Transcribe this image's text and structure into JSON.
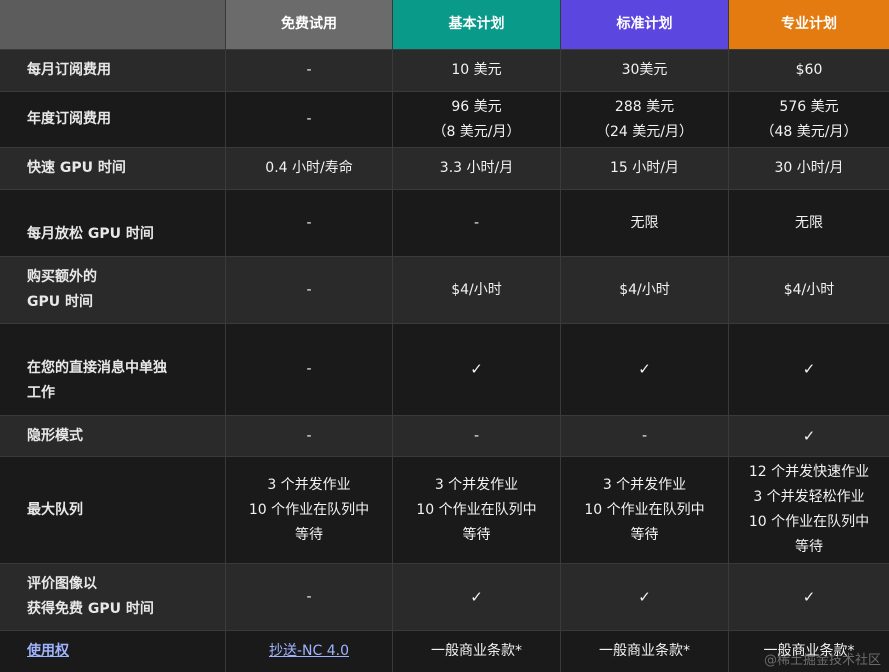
{
  "header": {
    "free": "免费试用",
    "basic": "基本计划",
    "standard": "标准计划",
    "pro": "专业计划"
  },
  "rows": {
    "monthly_fee": {
      "label": "每月订阅费用",
      "free": "-",
      "basic": "10 美元",
      "standard": "30美元",
      "pro": "$60"
    },
    "annual_fee": {
      "label": "年度订阅费用",
      "free": "-",
      "basic_1": "96 美元",
      "basic_2": "（8 美元/月）",
      "standard_1": "288 美元",
      "standard_2": "（24 美元/月）",
      "pro_1": "576 美元",
      "pro_2": "（48 美元/月）"
    },
    "fast_gpu": {
      "label": "快速 GPU 时间",
      "free": "0.4 小时/寿命",
      "basic": "3.3 小时/月",
      "standard": "15 小时/月",
      "pro": "30 小时/月"
    },
    "relax_gpu": {
      "label": "每月放松 GPU 时间",
      "free": "-",
      "basic": "-",
      "standard": "无限",
      "pro": "无限"
    },
    "extra_gpu": {
      "label_1": "购买额外的",
      "label_2": "GPU 时间",
      "free": "-",
      "basic": "$4/小时",
      "standard": "$4/小时",
      "pro": "$4/小时"
    },
    "dm_work": {
      "label_1": "在您的直接消息中单独",
      "label_2": "工作",
      "free": "-",
      "basic": "✓",
      "standard": "✓",
      "pro": "✓"
    },
    "stealth": {
      "label": "隐形模式",
      "free": "-",
      "basic": "-",
      "standard": "-",
      "pro": "✓"
    },
    "queue": {
      "label": "最大队列",
      "free_1": "3 个并发作业",
      "free_2": "10 个作业在队列中",
      "free_3": "等待",
      "basic_1": "3 个并发作业",
      "basic_2": "10 个作业在队列中",
      "basic_3": "等待",
      "standard_1": "3 个并发作业",
      "standard_2": "10 个作业在队列中",
      "standard_3": "等待",
      "pro_1": "12 个并发快速作业",
      "pro_2": "3 个并发轻松作业",
      "pro_3": "10 个作业在队列中",
      "pro_4": "等待"
    },
    "rate_images": {
      "label_1": "评价图像以",
      "label_2": "获得免费 GPU 时间",
      "free": "-",
      "basic": "✓",
      "standard": "✓",
      "pro": "✓"
    },
    "usage_rights": {
      "label": "使用权",
      "free": "抄送-NC 4.0",
      "basic": "一般商业条款*",
      "standard": "一般商业条款*",
      "pro": "一般商业条款*"
    }
  },
  "watermark": "@稀土掘金技术社区"
}
